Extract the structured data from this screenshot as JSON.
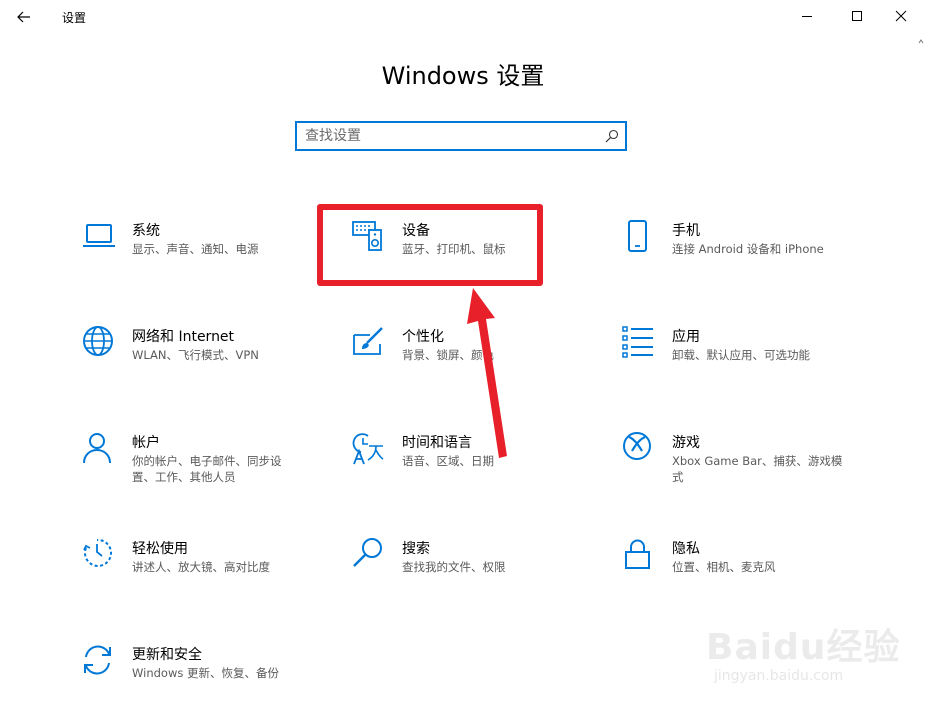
{
  "window": {
    "app_title": "设置",
    "back_icon": "back-arrow-icon",
    "minimize_icon": "minimize-icon",
    "maximize_icon": "maximize-icon",
    "close_icon": "close-icon"
  },
  "header": {
    "title": "Windows 设置"
  },
  "search": {
    "placeholder": "查找设置",
    "icon": "search-icon"
  },
  "tiles": [
    {
      "title": "系统",
      "desc": "显示、声音、通知、电源",
      "icon": "laptop-icon"
    },
    {
      "title": "设备",
      "desc": "蓝牙、打印机、鼠标",
      "icon": "keyboard-speaker-icon"
    },
    {
      "title": "手机",
      "desc": "连接 Android 设备和 iPhone",
      "icon": "phone-icon"
    },
    {
      "title": "网络和 Internet",
      "desc": "WLAN、飞行模式、VPN",
      "icon": "globe-icon"
    },
    {
      "title": "个性化",
      "desc": "背景、锁屏、颜色",
      "icon": "paint-brush-icon"
    },
    {
      "title": "应用",
      "desc": "卸载、默认应用、可选功能",
      "icon": "app-list-icon"
    },
    {
      "title": "帐户",
      "desc": "你的帐户、电子邮件、同步设置、工作、其他人员",
      "icon": "person-icon"
    },
    {
      "title": "时间和语言",
      "desc": "语音、区域、日期",
      "icon": "time-language-icon"
    },
    {
      "title": "游戏",
      "desc": "Xbox Game Bar、捕获、游戏模式",
      "icon": "xbox-icon"
    },
    {
      "title": "轻松使用",
      "desc": "讲述人、放大镜、高对比度",
      "icon": "ease-of-access-icon"
    },
    {
      "title": "搜索",
      "desc": "查找我的文件、权限",
      "icon": "magnifier-icon"
    },
    {
      "title": "隐私",
      "desc": "位置、相机、麦克风",
      "icon": "lock-icon"
    },
    {
      "title": "更新和安全",
      "desc": "Windows 更新、恢复、备份",
      "icon": "sync-icon"
    }
  ],
  "accent_color": "#0078d7",
  "annotation_color": "#e8202a",
  "watermark": {
    "logo": "Baidu经验",
    "url": "jingyan.baidu.com"
  }
}
